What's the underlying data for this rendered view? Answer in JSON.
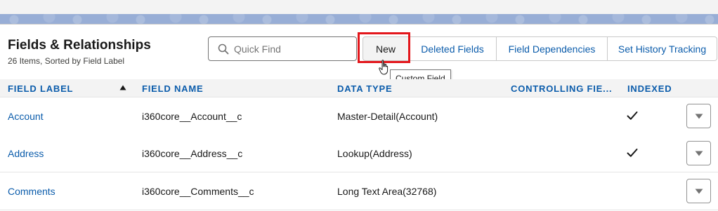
{
  "header": {
    "title": "Fields & Relationships",
    "subtitle": "26 Items, Sorted by Field Label"
  },
  "search": {
    "placeholder": "Quick Find",
    "value": ""
  },
  "toolbar": {
    "new_label": "New",
    "deleted_fields_label": "Deleted Fields",
    "field_dependencies_label": "Field Dependencies",
    "set_history_tracking_label": "Set History Tracking"
  },
  "tooltip": {
    "text": "Custom Field"
  },
  "table": {
    "columns": {
      "field_label": "FIELD LABEL",
      "field_name": "FIELD NAME",
      "data_type": "DATA TYPE",
      "controlling_field": "CONTROLLING FIE...",
      "indexed": "INDEXED"
    },
    "sort": {
      "column": "field_label",
      "direction": "ascending",
      "icon": "arrow-up-icon"
    },
    "rows": [
      {
        "field_label": "Account",
        "field_name": "i360core__Account__c",
        "data_type": "Master-Detail(Account)",
        "controlling_field": "",
        "indexed": true
      },
      {
        "field_label": "Address",
        "field_name": "i360core__Address__c",
        "data_type": "Lookup(Address)",
        "controlling_field": "",
        "indexed": true
      },
      {
        "field_label": "Comments",
        "field_name": "i360core__Comments__c",
        "data_type": "Long Text Area(32768)",
        "controlling_field": "",
        "indexed": false
      }
    ]
  },
  "icons": {
    "search": "search-icon",
    "check": "check-icon",
    "row_menu": "chevron-down-icon",
    "cursor": "hand-pointer-icon"
  },
  "colors": {
    "link": "#0b5cab",
    "highlight": "#e3161b",
    "header_bg": "#f3f3f3",
    "banner": "#98aed6"
  }
}
